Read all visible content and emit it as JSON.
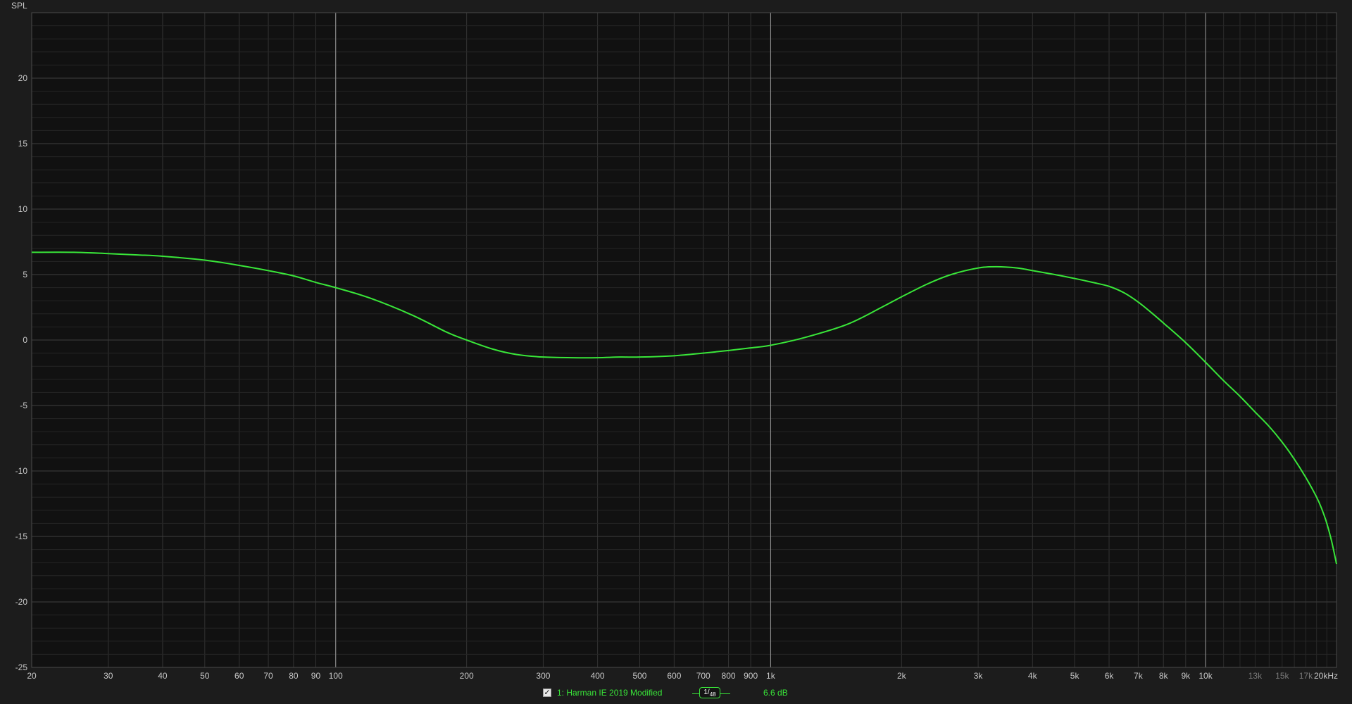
{
  "colors": {
    "background": "#1c1c1c",
    "plot_background": "#111111",
    "grid_minor": "#333333",
    "grid_major": "#9a9a9a",
    "trace": "#39e639"
  },
  "legend": {
    "checked": true,
    "trace_name": "1: Harman IE 2019 Modified",
    "smoothing_numerator": "1/",
    "smoothing_denominator": "48",
    "offset": "6.6 dB"
  },
  "chart_data": {
    "type": "line",
    "xlabel": "",
    "ylabel": "SPL",
    "x_scale": "log",
    "xlim": [
      20,
      20000
    ],
    "ylim": [
      -25,
      25
    ],
    "grid": true,
    "y_ticks": [
      {
        "value": 20,
        "label": "20"
      },
      {
        "value": 15,
        "label": "15"
      },
      {
        "value": 10,
        "label": "10"
      },
      {
        "value": 5,
        "label": "5"
      },
      {
        "value": 0,
        "label": "0"
      },
      {
        "value": -5,
        "label": "-5"
      },
      {
        "value": -10,
        "label": "-10"
      },
      {
        "value": -15,
        "label": "-15"
      },
      {
        "value": -20,
        "label": "-20"
      },
      {
        "value": -25,
        "label": "-25"
      }
    ],
    "x_ticks": [
      {
        "value": 20,
        "label": "20"
      },
      {
        "value": 30,
        "label": "30"
      },
      {
        "value": 40,
        "label": "40"
      },
      {
        "value": 50,
        "label": "50"
      },
      {
        "value": 60,
        "label": "60"
      },
      {
        "value": 70,
        "label": "70"
      },
      {
        "value": 80,
        "label": "80"
      },
      {
        "value": 90,
        "label": "90"
      },
      {
        "value": 100,
        "label": "100",
        "major": true
      },
      {
        "value": 200,
        "label": "200"
      },
      {
        "value": 300,
        "label": "300"
      },
      {
        "value": 400,
        "label": "400"
      },
      {
        "value": 500,
        "label": "500"
      },
      {
        "value": 600,
        "label": "600"
      },
      {
        "value": 700,
        "label": "700"
      },
      {
        "value": 800,
        "label": "800"
      },
      {
        "value": 900,
        "label": "900"
      },
      {
        "value": 1000,
        "label": "1k",
        "major": true
      },
      {
        "value": 2000,
        "label": "2k"
      },
      {
        "value": 3000,
        "label": "3k"
      },
      {
        "value": 4000,
        "label": "4k"
      },
      {
        "value": 5000,
        "label": "5k"
      },
      {
        "value": 6000,
        "label": "6k"
      },
      {
        "value": 7000,
        "label": "7k"
      },
      {
        "value": 8000,
        "label": "8k"
      },
      {
        "value": 9000,
        "label": "9k"
      },
      {
        "value": 10000,
        "label": "10k",
        "major": true
      },
      {
        "value": 13000,
        "label": "13k",
        "dim": true
      },
      {
        "value": 15000,
        "label": "15k",
        "dim": true
      },
      {
        "value": 17000,
        "label": "17k",
        "dim": true
      },
      {
        "value": 20000,
        "label": "20kHz"
      }
    ],
    "series": [
      {
        "name": "1: Harman IE 2019 Modified",
        "color": "#39e639",
        "points": [
          [
            20,
            6.7
          ],
          [
            25,
            6.7
          ],
          [
            30,
            6.6
          ],
          [
            35,
            6.5
          ],
          [
            40,
            6.4
          ],
          [
            50,
            6.1
          ],
          [
            60,
            5.7
          ],
          [
            70,
            5.3
          ],
          [
            80,
            4.9
          ],
          [
            90,
            4.4
          ],
          [
            100,
            4.0
          ],
          [
            120,
            3.2
          ],
          [
            150,
            1.9
          ],
          [
            180,
            0.6
          ],
          [
            200,
            0.0
          ],
          [
            230,
            -0.7
          ],
          [
            260,
            -1.1
          ],
          [
            300,
            -1.3
          ],
          [
            350,
            -1.35
          ],
          [
            400,
            -1.35
          ],
          [
            450,
            -1.3
          ],
          [
            500,
            -1.3
          ],
          [
            600,
            -1.2
          ],
          [
            700,
            -1.0
          ],
          [
            800,
            -0.8
          ],
          [
            900,
            -0.6
          ],
          [
            1000,
            -0.4
          ],
          [
            1200,
            0.2
          ],
          [
            1500,
            1.2
          ],
          [
            1800,
            2.5
          ],
          [
            2000,
            3.3
          ],
          [
            2300,
            4.3
          ],
          [
            2600,
            5.0
          ],
          [
            3000,
            5.5
          ],
          [
            3300,
            5.6
          ],
          [
            3700,
            5.5
          ],
          [
            4000,
            5.3
          ],
          [
            4500,
            5.0
          ],
          [
            5000,
            4.7
          ],
          [
            5500,
            4.4
          ],
          [
            6000,
            4.1
          ],
          [
            6500,
            3.6
          ],
          [
            7000,
            2.9
          ],
          [
            7500,
            2.1
          ],
          [
            8000,
            1.3
          ],
          [
            9000,
            -0.2
          ],
          [
            10000,
            -1.7
          ],
          [
            11000,
            -3.1
          ],
          [
            12000,
            -4.3
          ],
          [
            13000,
            -5.5
          ],
          [
            14000,
            -6.6
          ],
          [
            15000,
            -7.8
          ],
          [
            16000,
            -9.1
          ],
          [
            17000,
            -10.5
          ],
          [
            18000,
            -12.0
          ],
          [
            18500,
            -12.9
          ],
          [
            19000,
            -14.0
          ],
          [
            19500,
            -15.4
          ],
          [
            20000,
            -17.1
          ]
        ]
      }
    ]
  }
}
